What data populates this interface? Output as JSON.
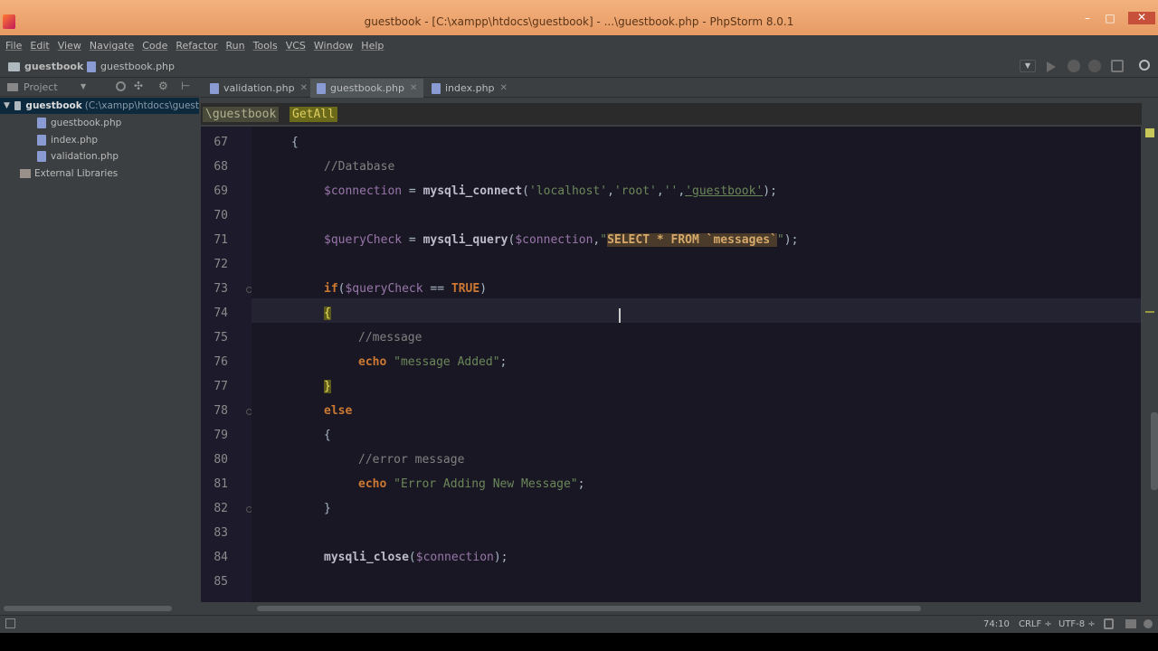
{
  "window": {
    "title": "guestbook - [C:\\xampp\\htdocs\\guestbook] - ...\\guestbook.php - PhpStorm 8.0.1"
  },
  "menu": [
    "File",
    "Edit",
    "View",
    "Navigate",
    "Code",
    "Refactor",
    "Run",
    "Tools",
    "VCS",
    "Window",
    "Help"
  ],
  "navbar": {
    "project": "guestbook",
    "file": "guestbook.php"
  },
  "project_panel": {
    "header": "Project",
    "root_name": "guestbook",
    "root_path": "(C:\\xampp\\htdocs\\guest",
    "files": [
      "guestbook.php",
      "index.php",
      "validation.php"
    ],
    "external": "External Libraries"
  },
  "tabs": [
    {
      "label": "validation.php",
      "active": false
    },
    {
      "label": "guestbook.php",
      "active": true
    },
    {
      "label": "index.php",
      "active": false
    }
  ],
  "breadcrumb": {
    "class": "\\guestbook",
    "method": "GetAll"
  },
  "editor": {
    "line_numbers": [
      "67",
      "68",
      "69",
      "70",
      "71",
      "72",
      "73",
      "74",
      "75",
      "76",
      "77",
      "78",
      "79",
      "80",
      "81",
      "82",
      "83",
      "84",
      "85"
    ],
    "lines": {
      "l67": "{",
      "l68": "//Database",
      "l69_var": "$connection",
      "l69_op": " = ",
      "l69_fn": "mysqli_connect",
      "l69_a": "(",
      "l69_s1": "'localhost'",
      "l69_c1": ",",
      "l69_s2": "'root'",
      "l69_c2": ",",
      "l69_s3": "''",
      "l69_c3": ",",
      "l69_s4": "'guestbook'",
      "l69_end": ");",
      "l71_var": "$queryCheck",
      "l71_op": " = ",
      "l71_fn": "mysqli_query",
      "l71_a": "(",
      "l71_var2": "$connection",
      "l71_c": ",",
      "l71_q1": "\"",
      "l71_sql": "SELECT * FROM `messages`",
      "l71_q2": "\"",
      "l71_end": ");",
      "l73_kw": "if",
      "l73_a": "(",
      "l73_var": "$queryCheck",
      "l73_op": " == ",
      "l73_kw2": "TRUE",
      "l73_b": ")",
      "l74": "{",
      "l75": "//message",
      "l76_kw": "echo",
      "l76_str": " \"message Added\"",
      "l76_end": ";",
      "l77": "}",
      "l78": "else",
      "l79": "{",
      "l80": "//error message",
      "l81_kw": "echo",
      "l81_str": " \"Error Adding New Message\"",
      "l81_end": ";",
      "l82": "}",
      "l84_fn": "mysqli_close",
      "l84_a": "(",
      "l84_var": "$connection",
      "l84_end": ");"
    }
  },
  "status": {
    "position": "74:10",
    "line_sep": "CRLF ÷",
    "encoding": "UTF-8 ÷"
  },
  "colors": {
    "titlebar": "#e89a63",
    "editor_bg": "#1a1724",
    "keyword": "#cc7832",
    "string": "#6a8759",
    "variable": "#9876aa"
  }
}
